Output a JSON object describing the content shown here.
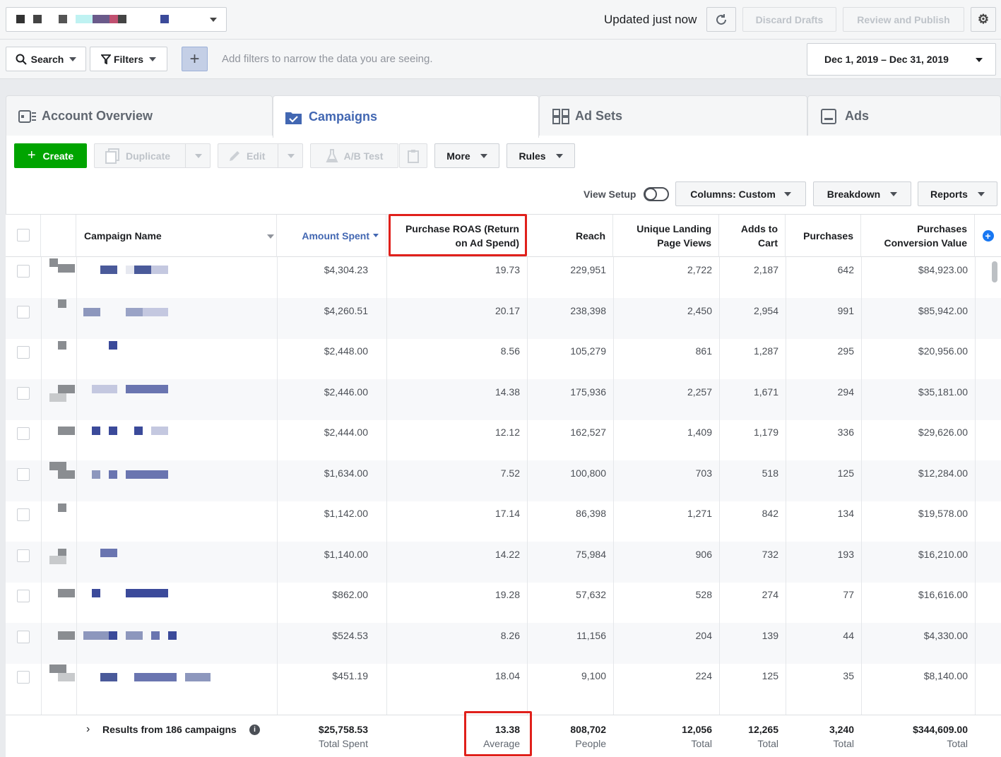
{
  "topbar": {
    "status": "Updated just now",
    "discard": "Discard Drafts",
    "review": "Review and Publish"
  },
  "filterbar": {
    "search": "Search",
    "filters": "Filters",
    "hint": "Add filters to narrow the data you are seeing.",
    "date_range": "Dec 1, 2019 – Dec 31, 2019"
  },
  "tabs": [
    {
      "label": "Account Overview"
    },
    {
      "label": "Campaigns"
    },
    {
      "label": "Ad Sets"
    },
    {
      "label": "Ads"
    }
  ],
  "toolbar": {
    "create": "Create",
    "duplicate": "Duplicate",
    "edit": "Edit",
    "ab_test": "A/B Test",
    "more": "More",
    "rules": "Rules",
    "view_setup": "View Setup",
    "columns_prefix": "Columns: ",
    "columns_value": "Custom",
    "breakdown": "Breakdown",
    "reports": "Reports"
  },
  "columns": {
    "name": "Campaign Name",
    "spent": "Amount Spent",
    "roas_1": "Purchase ROAS (Return",
    "roas_2": "on Ad Spend)",
    "reach": "Reach",
    "ulpv_1": "Unique Landing",
    "ulpv_2": "Page Views",
    "atc_1": "Adds to",
    "atc_2": "Cart",
    "purchases": "Purchases",
    "pcv_1": "Purchases",
    "pcv_2": "Conversion Value"
  },
  "rows": [
    {
      "spent": "$4,304.23",
      "roas": "19.73",
      "reach": "229,951",
      "ulpv": "2,722",
      "atc": "2,187",
      "purchases": "642",
      "pcv": "$84,923.00"
    },
    {
      "spent": "$4,260.51",
      "roas": "20.17",
      "reach": "238,398",
      "ulpv": "2,450",
      "atc": "2,954",
      "purchases": "991",
      "pcv": "$85,942.00"
    },
    {
      "spent": "$2,448.00",
      "roas": "8.56",
      "reach": "105,279",
      "ulpv": "861",
      "atc": "1,287",
      "purchases": "295",
      "pcv": "$20,956.00"
    },
    {
      "spent": "$2,446.00",
      "roas": "14.38",
      "reach": "175,936",
      "ulpv": "2,257",
      "atc": "1,671",
      "purchases": "294",
      "pcv": "$35,181.00"
    },
    {
      "spent": "$2,444.00",
      "roas": "12.12",
      "reach": "162,527",
      "ulpv": "1,409",
      "atc": "1,179",
      "purchases": "336",
      "pcv": "$29,626.00"
    },
    {
      "spent": "$1,634.00",
      "roas": "7.52",
      "reach": "100,800",
      "ulpv": "703",
      "atc": "518",
      "purchases": "125",
      "pcv": "$12,284.00"
    },
    {
      "spent": "$1,142.00",
      "roas": "17.14",
      "reach": "86,398",
      "ulpv": "1,271",
      "atc": "842",
      "purchases": "134",
      "pcv": "$19,578.00"
    },
    {
      "spent": "$1,140.00",
      "roas": "14.22",
      "reach": "75,984",
      "ulpv": "906",
      "atc": "732",
      "purchases": "193",
      "pcv": "$16,210.00"
    },
    {
      "spent": "$862.00",
      "roas": "19.28",
      "reach": "57,632",
      "ulpv": "528",
      "atc": "274",
      "purchases": "77",
      "pcv": "$16,616.00"
    },
    {
      "spent": "$524.53",
      "roas": "8.26",
      "reach": "11,156",
      "ulpv": "204",
      "atc": "139",
      "purchases": "44",
      "pcv": "$4,330.00"
    },
    {
      "spent": "$451.19",
      "roas": "18.04",
      "reach": "9,100",
      "ulpv": "224",
      "atc": "125",
      "purchases": "35",
      "pcv": "$8,140.00"
    }
  ],
  "footer": {
    "results": "Results from 186 campaigns",
    "spent": "$25,758.53",
    "spent_lbl": "Total Spent",
    "roas": "13.38",
    "roas_lbl": "Average",
    "reach": "808,702",
    "reach_lbl": "People",
    "ulpv": "12,056",
    "ulpv_lbl": "Total",
    "atc": "12,265",
    "atc_lbl": "Total",
    "purchases": "3,240",
    "purchases_lbl": "Total",
    "pcv": "$344,609.00",
    "pcv_lbl": "Total"
  },
  "colors": {
    "accent": "#4267b2",
    "create": "#00a400",
    "highlight": "#e0201b"
  }
}
